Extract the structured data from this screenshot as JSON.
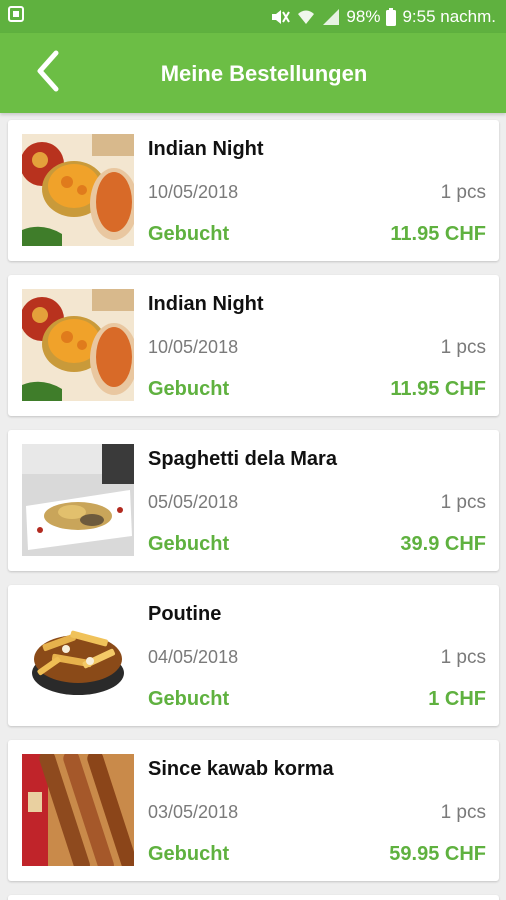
{
  "status_bar": {
    "battery": "98%",
    "time": "9:55 nachm."
  },
  "app_bar": {
    "title": "Meine Bestellungen"
  },
  "colors": {
    "primary": "#6cbe45",
    "status_bar": "#5fb13f",
    "accent_text": "#5fb13f"
  },
  "orders": [
    {
      "name": "Indian Night",
      "date": "10/05/2018",
      "quantity": "1 pcs",
      "status": "Gebucht",
      "price": "11.95 CHF",
      "image": "indian-curry-dishes"
    },
    {
      "name": "Indian Night",
      "date": "10/05/2018",
      "quantity": "1 pcs",
      "status": "Gebucht",
      "price": "11.95 CHF",
      "image": "indian-curry-dishes"
    },
    {
      "name": "Spaghetti dela Mara",
      "date": "05/05/2018",
      "quantity": "1 pcs",
      "status": "Gebucht",
      "price": "39.9 CHF",
      "image": "spaghetti-plate"
    },
    {
      "name": "Poutine",
      "date": "04/05/2018",
      "quantity": "1 pcs",
      "status": "Gebucht",
      "price": "1 CHF",
      "image": "poutine-fries"
    },
    {
      "name": "Since kawab korma",
      "date": "03/05/2018",
      "quantity": "1 pcs",
      "status": "Gebucht",
      "price": "59.95 CHF",
      "image": "kebab-skewers"
    }
  ]
}
